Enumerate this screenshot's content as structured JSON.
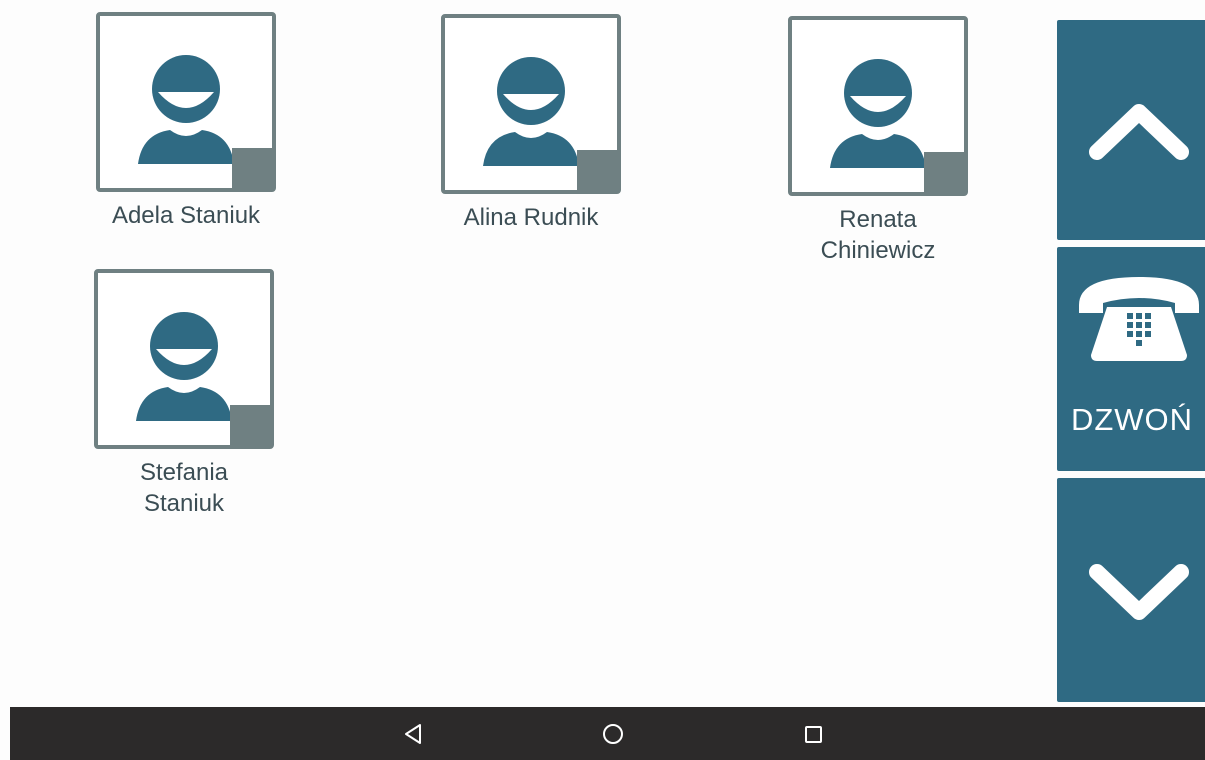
{
  "contacts": [
    {
      "name": "Adela Staniuk"
    },
    {
      "name": "Alina Rudnik"
    },
    {
      "name": "Renata Chiniewicz"
    },
    {
      "name": "Stefania Staniuk"
    }
  ],
  "side_panel": {
    "call_label": "DZWOŃ"
  },
  "icons": {
    "scroll_up": "chevron-up-icon",
    "call": "telephone-icon",
    "scroll_down": "chevron-down-icon",
    "nav_back": "back-triangle-icon",
    "nav_home": "home-circle-icon",
    "nav_recents": "recents-square-icon"
  },
  "colors": {
    "accent": "#2f6a83",
    "avatar_frame": "#6f8082",
    "text": "#3b4d54",
    "nav_bar": "#2c2a2a"
  }
}
